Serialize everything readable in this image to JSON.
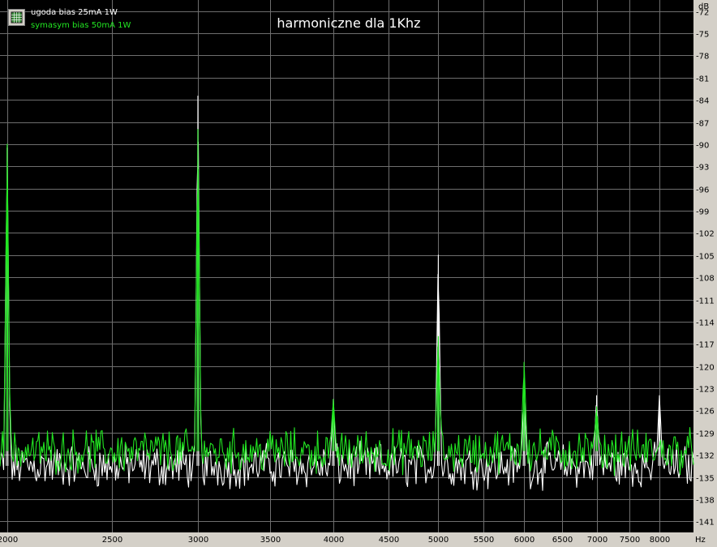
{
  "chart_data": {
    "type": "line",
    "title": "harmoniczne dla 1Khz",
    "xlabel": "",
    "ylabel": "",
    "x_unit": "Hz",
    "y_unit": "dB",
    "x_scale": "log",
    "xlim": [
      1970,
      8600
    ],
    "ylim": [
      -142.5,
      -70.5
    ],
    "xticks": [
      2000,
      2500,
      3000,
      3500,
      4000,
      4500,
      5000,
      5500,
      6000,
      6500,
      7000,
      7500,
      8000
    ],
    "xtick_labels": [
      "2000",
      "2500",
      "3000",
      "3500",
      "4000",
      "4500",
      "5000",
      "5500",
      "6000",
      "6500",
      "7000",
      "7500",
      "8000"
    ],
    "yticks": [
      -72,
      -75,
      -78,
      -81,
      -84,
      -87,
      -90,
      -93,
      -96,
      -99,
      -102,
      -105,
      -108,
      -111,
      -114,
      -117,
      -120,
      -123,
      -126,
      -129,
      -132,
      -135,
      -138,
      -141
    ],
    "ytick_labels": [
      "-72",
      "-75",
      "-78",
      "-81",
      "-84",
      "-87",
      "-90",
      "-93",
      "-96",
      "-99",
      "-102",
      "-105",
      "-108",
      "-111",
      "-114",
      "-117",
      "-120",
      "-123",
      "-126",
      "-129",
      "-132",
      "-135",
      "-138",
      "-141"
    ],
    "grid": true,
    "legend_position": "top-left",
    "background": "#000000",
    "series": [
      {
        "name": "ugoda bias 25mA 1W",
        "color": "#ffffff",
        "noise_floor_db": -133.5,
        "peaks": [
          {
            "x": 2000,
            "y": -90.5
          },
          {
            "x": 3000,
            "y": -83.5
          },
          {
            "x": 4000,
            "y": -124.5
          },
          {
            "x": 5000,
            "y": -105
          },
          {
            "x": 6000,
            "y": -124
          },
          {
            "x": 7000,
            "y": -124
          },
          {
            "x": 8000,
            "y": -124
          }
        ]
      },
      {
        "name": "symasym bias 50mA 1W",
        "color": "#22e622",
        "noise_floor_db": -131.5,
        "peaks": [
          {
            "x": 2000,
            "y": -90
          },
          {
            "x": 3000,
            "y": -88
          },
          {
            "x": 4000,
            "y": -124.5
          },
          {
            "x": 5000,
            "y": -116
          },
          {
            "x": 6000,
            "y": -119.5
          },
          {
            "x": 7000,
            "y": -125.5
          }
        ]
      }
    ]
  }
}
